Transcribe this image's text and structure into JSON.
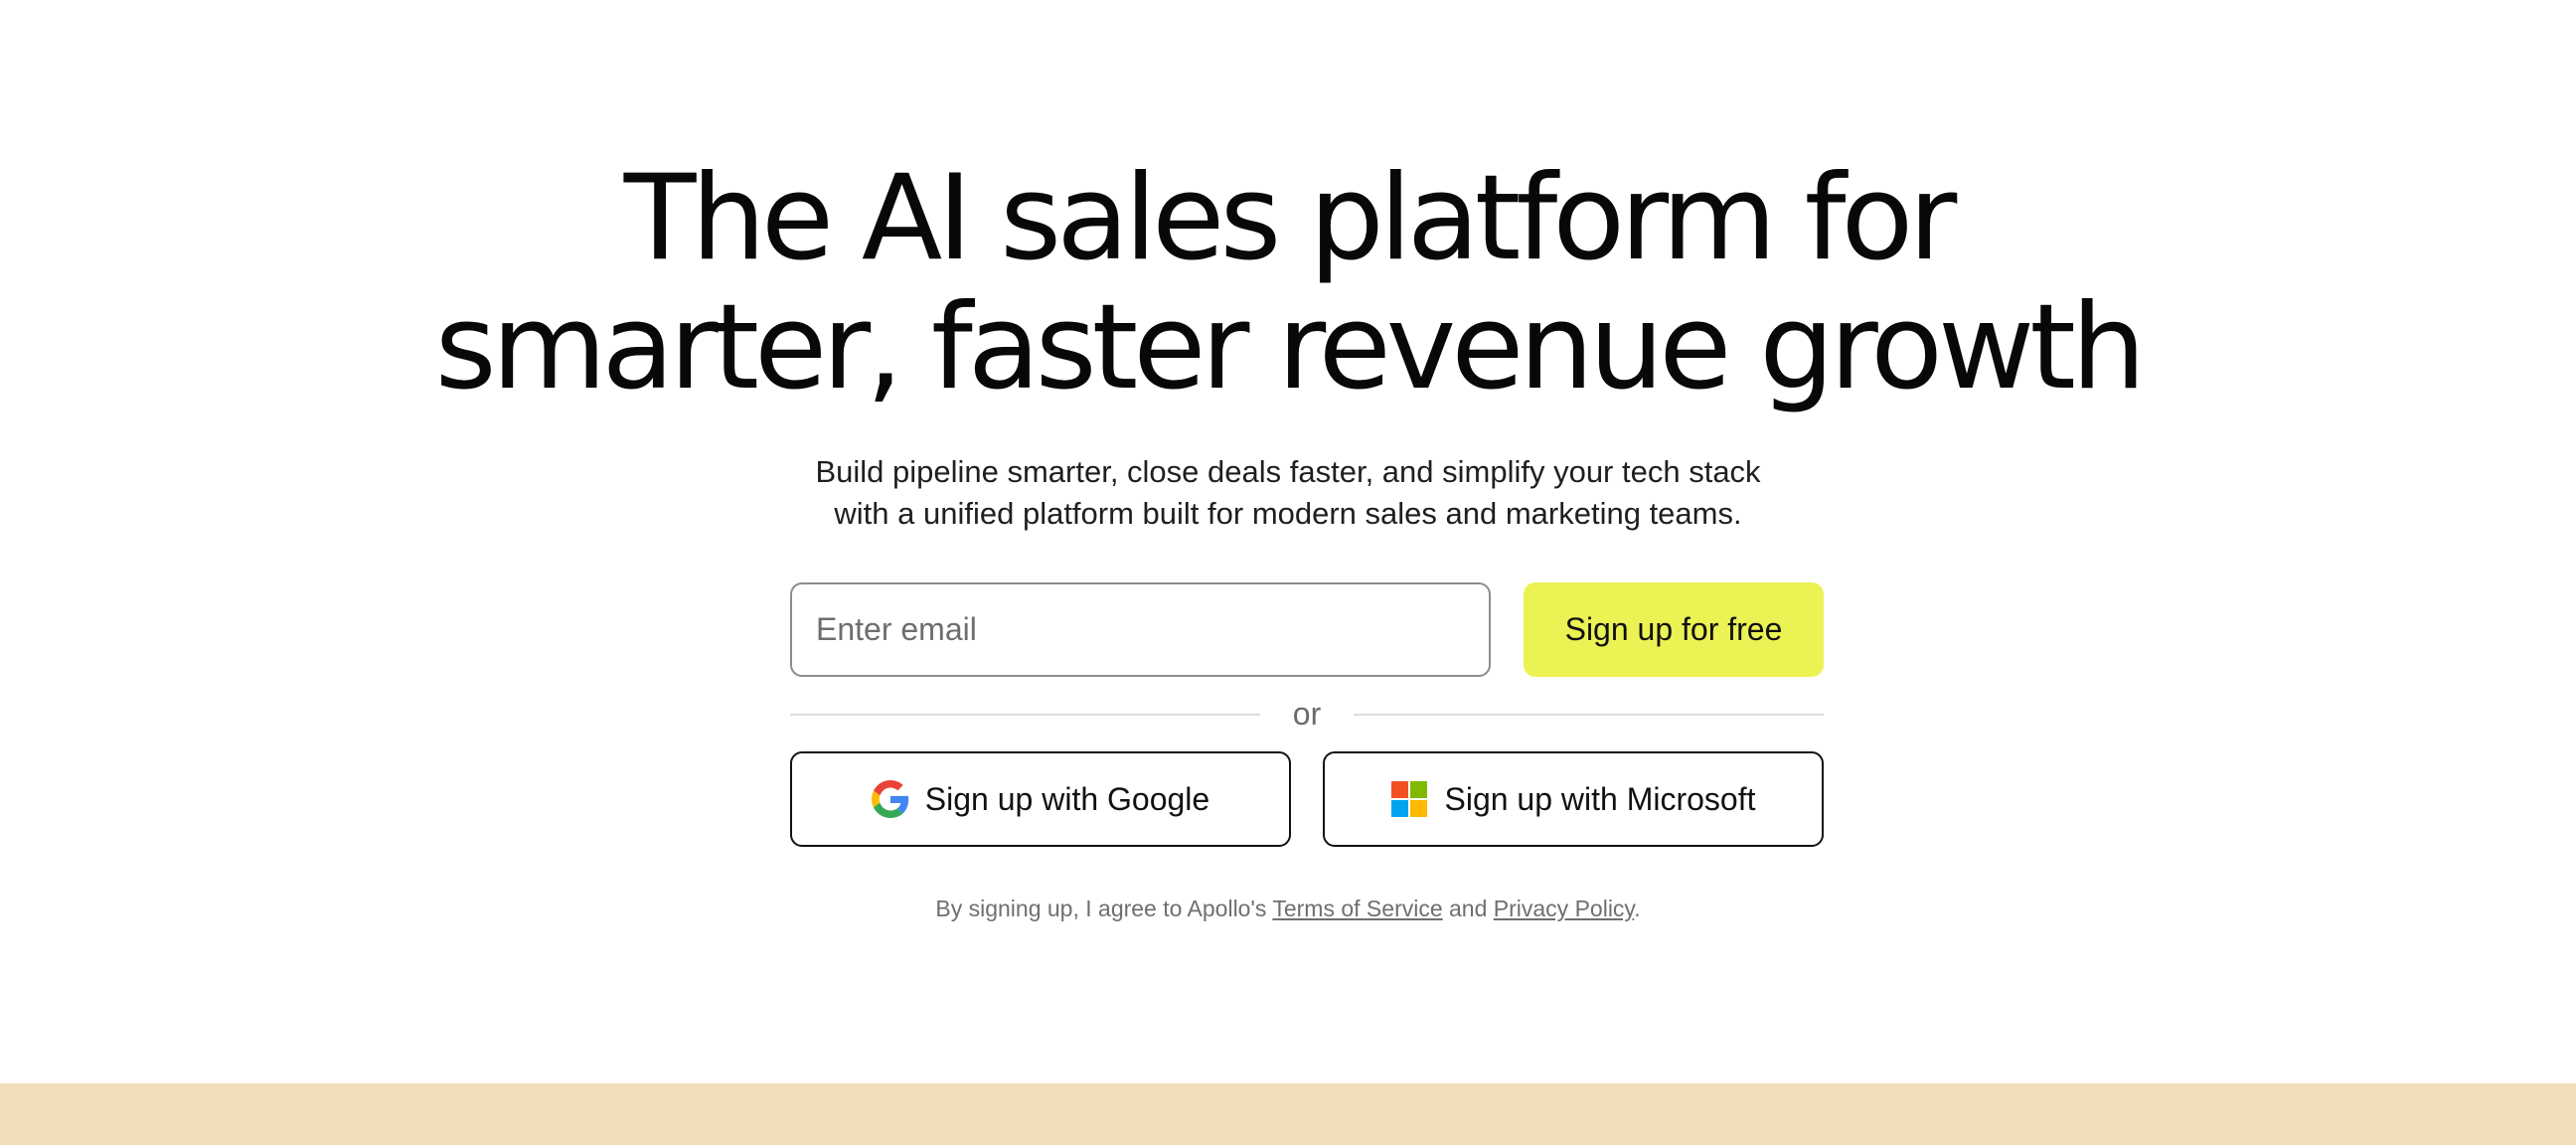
{
  "hero": {
    "headline_line1": "The AI sales platform for",
    "headline_line2": "smarter, faster revenue growth",
    "subtitle_line1": "Build pipeline smarter, close deals faster, and simplify your tech stack",
    "subtitle_line2": "with a unified platform built for modern sales and marketing teams."
  },
  "signup_form": {
    "email_placeholder": "Enter email",
    "email_value": "",
    "submit_label": "Sign up for free",
    "divider_text": "or",
    "google_label": "Sign up with Google",
    "microsoft_label": "Sign up with Microsoft",
    "google_icon": "google-logo-icon",
    "microsoft_icon": "microsoft-logo-icon"
  },
  "legal": {
    "prefix": "By signing up, I agree to Apollo's ",
    "terms_label": "Terms of Service",
    "conjunction": " and ",
    "privacy_label": "Privacy Policy",
    "suffix": "."
  },
  "colors": {
    "accent_button": "#ebf253",
    "bottom_band": "#f1deb8",
    "text_primary": "#080808",
    "text_muted": "#6f6f6f"
  }
}
